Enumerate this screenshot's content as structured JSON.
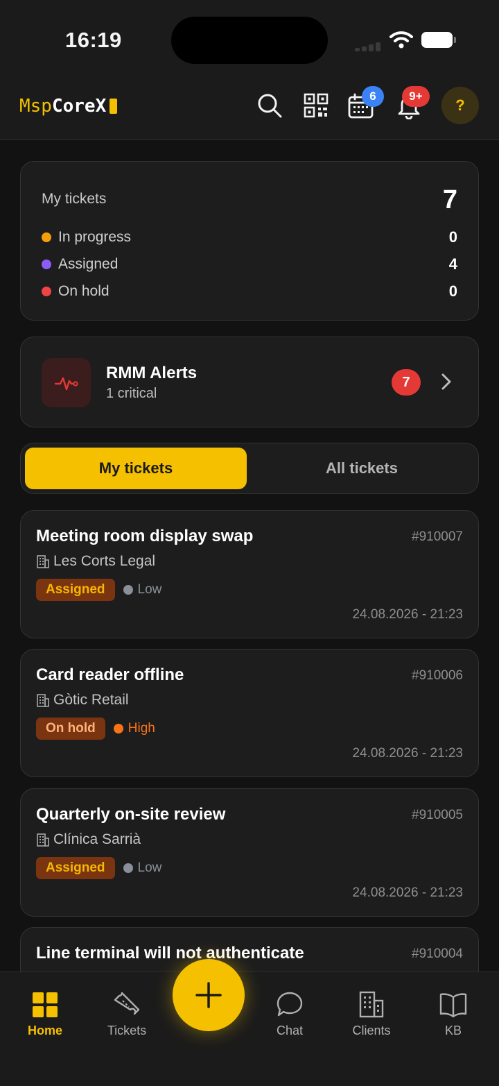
{
  "status_bar": {
    "time": "16:19"
  },
  "header": {
    "logo_prefix": "Msp",
    "logo_brand": "CoreX",
    "calendar_badge": "6",
    "notifications_badge": "9+",
    "help_label": "?"
  },
  "summary": {
    "title": "My tickets",
    "total": "7",
    "rows": [
      {
        "label": "In progress",
        "count": "0",
        "color": "#f59e0b"
      },
      {
        "label": "Assigned",
        "count": "4",
        "color": "#8b5cf6"
      },
      {
        "label": "On hold",
        "count": "0",
        "color": "#ef4444"
      }
    ]
  },
  "rmm": {
    "title": "RMM Alerts",
    "subtitle": "1 critical",
    "count": "7"
  },
  "tabs": {
    "active": "My tickets",
    "inactive": "All tickets"
  },
  "tickets": [
    {
      "title": "Meeting room display swap",
      "id": "#910007",
      "client": "Les Corts Legal",
      "status": "Assigned",
      "status_color": "#f5b800",
      "priority": "Low",
      "priority_color": "#8a8f99",
      "date": "24.08.2026 - 21:23"
    },
    {
      "title": "Card reader offline",
      "id": "#910006",
      "client": "Gòtic Retail",
      "status": "On hold",
      "status_color": "#ffb27a",
      "priority": "High",
      "priority_color": "#f97316",
      "date": "24.08.2026 - 21:23"
    },
    {
      "title": "Quarterly on-site review",
      "id": "#910005",
      "client": "Clínica Sarrià",
      "status": "Assigned",
      "status_color": "#f5b800",
      "priority": "Low",
      "priority_color": "#8a8f99",
      "date": "24.08.2026 - 21:23"
    },
    {
      "title": "Line terminal will not authenticate",
      "id": "#910004"
    }
  ],
  "nav": {
    "home": "Home",
    "tickets": "Tickets",
    "chat": "Chat",
    "clients": "Clients",
    "kb": "KB"
  },
  "colors": {
    "accent": "#f5c000",
    "background": "#121212",
    "card": "#1d1d1d",
    "danger": "#e53935",
    "info": "#3b82f6"
  }
}
